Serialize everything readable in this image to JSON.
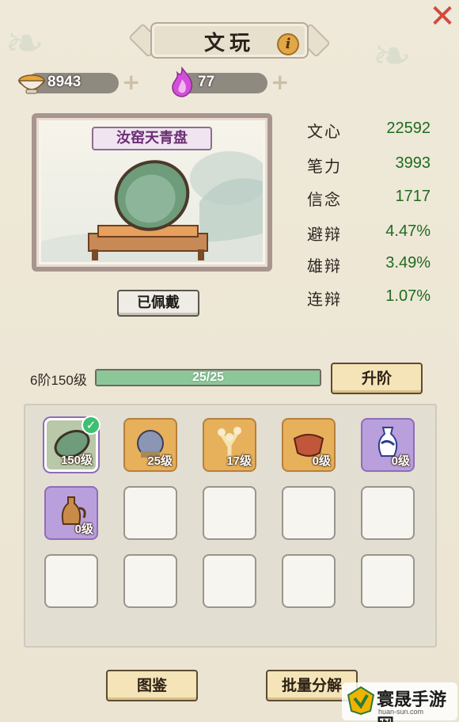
{
  "header": {
    "title": "文玩",
    "info_label": "i"
  },
  "currencies": [
    {
      "name": "ink",
      "value": "8943",
      "icon": "ink-bowl-icon"
    },
    {
      "name": "spirit",
      "value": "77",
      "icon": "purple-flame-icon"
    }
  ],
  "item": {
    "name": "汝窑天青盘",
    "worn_label": "已佩戴"
  },
  "stats": [
    {
      "name": "文心",
      "value": "22592"
    },
    {
      "name": "笔力",
      "value": "3993"
    },
    {
      "name": "信念",
      "value": "1717"
    },
    {
      "name": "避辩",
      "value": "4.47%"
    },
    {
      "name": "雄辩",
      "value": "3.49%"
    },
    {
      "name": "连辩",
      "value": "1.07%"
    }
  ],
  "level": {
    "label": "6阶150级",
    "progress_text": "25/25",
    "progress_fraction": 1.0,
    "upgrade_label": "升阶"
  },
  "grid": {
    "items": [
      {
        "level": "150级",
        "rarity": "green",
        "selected": true,
        "icon": "celadon-dish-icon"
      },
      {
        "level": "25级",
        "rarity": "orange",
        "selected": false,
        "icon": "incense-burner-icon"
      },
      {
        "level": "17级",
        "rarity": "orange",
        "selected": false,
        "icon": "coral-tree-icon"
      },
      {
        "level": "0级",
        "rarity": "orange",
        "selected": false,
        "icon": "ox-cup-icon"
      },
      {
        "level": "0级",
        "rarity": "purple",
        "selected": false,
        "icon": "blue-white-vase-icon"
      },
      {
        "level": "0级",
        "rarity": "purple",
        "selected": false,
        "icon": "bronze-ewer-icon"
      }
    ]
  },
  "bottom": {
    "catalog_label": "图鉴",
    "batch_decompose_label": "批量分解"
  },
  "watermark": {
    "main": "寰晟手游网",
    "sub": "huan-sun.com"
  },
  "colors": {
    "stat_value": "#1f6b1f",
    "progress_fill": "#8cc79a",
    "close": "#d24a3a",
    "item_name": "#6b2e73"
  }
}
